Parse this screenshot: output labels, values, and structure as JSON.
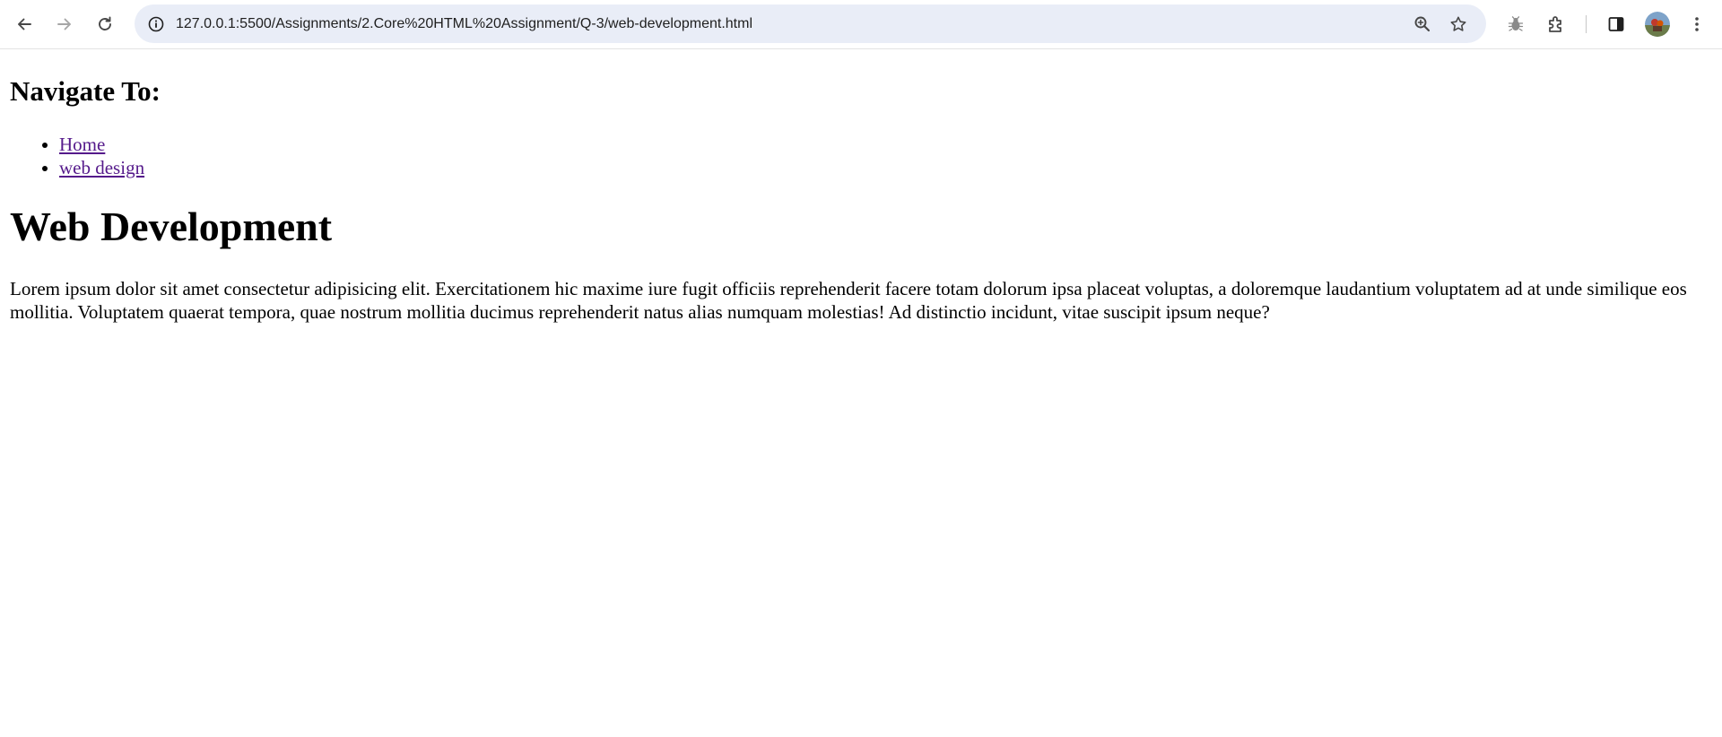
{
  "browser": {
    "url": "127.0.0.1:5500/Assignments/2.Core%20HTML%20Assignment/Q-3/web-development.html",
    "icons": {
      "back": "arrow-left-icon",
      "forward": "arrow-right-icon",
      "reload": "reload-icon",
      "site_info": "site-info-icon",
      "zoom": "zoom-icon",
      "bookmark": "star-icon",
      "extension": "bug-icon",
      "extensions_menu": "puzzle-icon",
      "side_panel": "side-panel-icon",
      "profile": "avatar",
      "menu": "kebab-menu-icon"
    },
    "colors": {
      "omnibox_bg": "#e9edf7",
      "link_visited": "#551a8b"
    }
  },
  "page": {
    "nav_heading": "Navigate To:",
    "nav_links": [
      {
        "label": "Home"
      },
      {
        "label": "web design"
      }
    ],
    "title": "Web Development",
    "paragraph": "Lorem ipsum dolor sit amet consectetur adipisicing elit. Exercitationem hic maxime iure fugit officiis reprehenderit facere totam dolorum ipsa placeat voluptas, a doloremque laudantium voluptatem ad at unde similique eos mollitia. Voluptatem quaerat tempora, quae nostrum mollitia ducimus reprehenderit natus alias numquam molestias! Ad distinctio incidunt, vitae suscipit ipsum neque?"
  }
}
